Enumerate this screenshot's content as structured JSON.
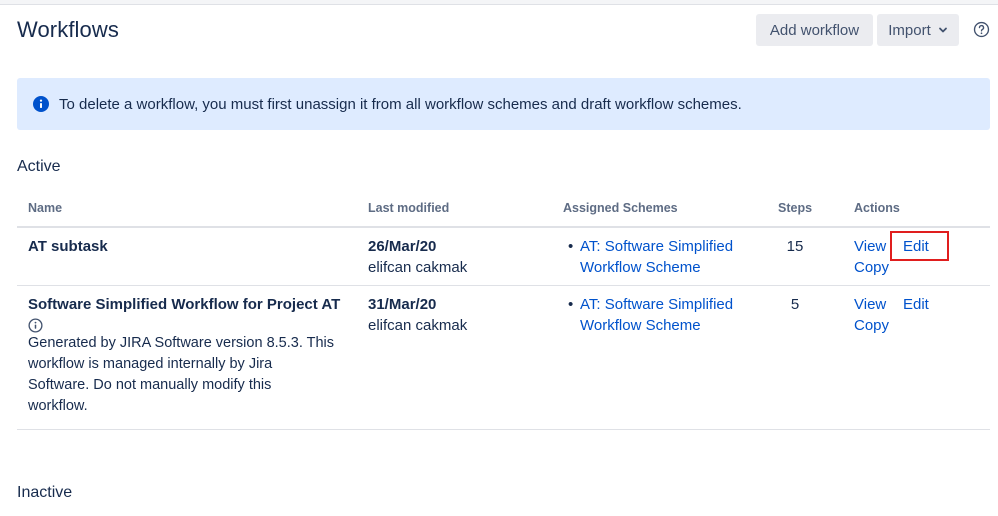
{
  "header": {
    "title": "Workflows",
    "add_workflow_label": "Add workflow",
    "import_label": "Import"
  },
  "banner": {
    "message": "To delete a workflow, you must first unassign it from all workflow schemes and draft workflow schemes."
  },
  "sections": {
    "active": "Active",
    "inactive": "Inactive"
  },
  "table": {
    "columns": [
      "Name",
      "Last modified",
      "Assigned Schemes",
      "Steps",
      "Actions"
    ],
    "rows": [
      {
        "name": "AT subtask",
        "description": "",
        "modified_date": "26/Mar/20",
        "modified_by": "elifcan cakmak",
        "scheme_line1": "AT: Software Simplified",
        "scheme_line2": "Workflow Scheme",
        "steps": "15",
        "actions": [
          "View",
          "Edit",
          "Copy"
        ]
      },
      {
        "name": "Software Simplified Workflow for Project AT",
        "description_lines": [
          "Generated by JIRA Software version 8.5.3. This",
          "workflow is managed internally by Jira",
          "Software. Do not manually modify this",
          "workflow."
        ],
        "modified_date": "31/Mar/20",
        "modified_by": "elifcan cakmak",
        "scheme_line1": "AT: Software Simplified",
        "scheme_line2": "Workflow Scheme",
        "steps": "5",
        "actions": [
          "View",
          "Edit",
          "Copy"
        ]
      }
    ]
  },
  "icons": {
    "info": "info-icon",
    "help": "help-icon",
    "chevron": "chevron-down-icon"
  },
  "colors": {
    "link": "#0052cc",
    "banner_bg": "#deebff",
    "info_blue": "#0052cc",
    "highlight": "#e01e1e"
  }
}
